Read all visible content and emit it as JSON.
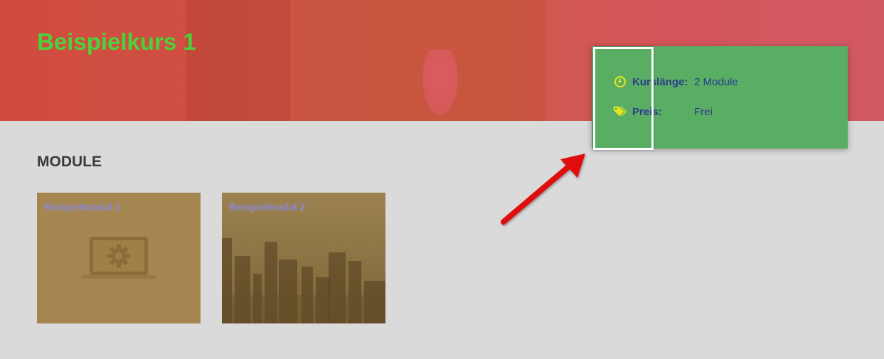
{
  "course": {
    "title": "Beispielkurs 1"
  },
  "info": {
    "length_label": "Kurslänge:",
    "length_value": "2 Module",
    "price_label": "Preis:",
    "price_value": "Frei"
  },
  "modules_section": {
    "title": "MODULE",
    "items": [
      {
        "title": "Beispielmodul 1",
        "image": "laptop-gear-icon"
      },
      {
        "title": "Beispielmodul 2",
        "image": "city-skyline-photo"
      }
    ]
  },
  "colors": {
    "title": "#4cd03c",
    "card": "#5aae64",
    "label": "#2b3b8c",
    "icon": "#e3e61e",
    "module_bg": "#a58650",
    "arrow": "#e01010"
  },
  "icons": [
    "clock-icon",
    "tags-icon",
    "laptop-gear-icon"
  ]
}
